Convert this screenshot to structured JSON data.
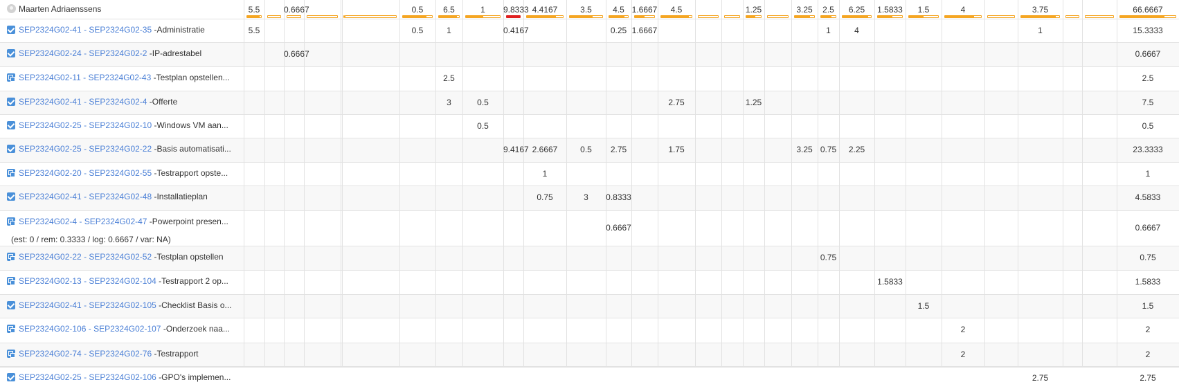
{
  "header": {
    "user_name": "Maarten Adriaenssens",
    "totals": [
      "5.5",
      "",
      "0.6667",
      "",
      "",
      "",
      "0.5",
      "6.5",
      "1",
      "9.8333",
      "4.4167",
      "3.5",
      "4.5",
      "1.6667",
      "4.5",
      "",
      "",
      "1.25",
      "",
      "3.25",
      "2.5",
      "6.25",
      "1.5833",
      "1.5",
      "4",
      "",
      "3.75",
      "",
      "",
      "66.6667"
    ],
    "bar_fill": [
      0.9,
      0,
      0,
      0,
      0,
      0,
      0.8,
      0.9,
      0.5,
      1.0,
      0.8,
      0.7,
      0.8,
      0.5,
      0.9,
      0,
      0,
      0.6,
      0,
      0.8,
      0.7,
      0.9,
      0.6,
      0.5,
      0.8,
      0,
      0.9,
      0,
      0,
      0.8
    ],
    "bar_over": [
      false,
      false,
      false,
      false,
      false,
      false,
      false,
      false,
      false,
      true,
      false,
      false,
      false,
      false,
      false,
      false,
      false,
      false,
      false,
      false,
      false,
      false,
      false,
      false,
      false,
      false,
      false,
      false,
      false,
      false
    ],
    "colors": {
      "accent": "#f5a623",
      "over": "#e02020",
      "link": "#4a7fd6",
      "checkbox": "#4a90d9"
    }
  },
  "rows": [
    {
      "icon": "checkbox-icon",
      "link": "SEP2324G02-41 - SEP2324G02-35",
      "title": " -Administratie",
      "cells": [
        "5.5",
        "",
        "",
        "",
        "",
        "",
        "0.5",
        "1",
        "",
        "0.4167",
        "",
        "",
        "0.25",
        "1.6667",
        "",
        "",
        "",
        "",
        "",
        "",
        "1",
        "4",
        "",
        "",
        "",
        "",
        "1",
        "",
        "",
        "15.3333"
      ]
    },
    {
      "icon": "checkbox-icon",
      "link": "SEP2324G02-24 - SEP2324G02-2",
      "title": " -IP-adrestabel",
      "cells": [
        "",
        "",
        "0.6667",
        "",
        "",
        "",
        "",
        "",
        "",
        "",
        "",
        "",
        "",
        "",
        "",
        "",
        "",
        "",
        "",
        "",
        "",
        "",
        "",
        "",
        "",
        "",
        "",
        "",
        "",
        "0.6667"
      ]
    },
    {
      "icon": "subtask-icon",
      "link": "SEP2324G02-11 - SEP2324G02-43",
      "title": " -Testplan opstellen...",
      "cells": [
        "",
        "",
        "",
        "",
        "",
        "",
        "",
        "2.5",
        "",
        "",
        "",
        "",
        "",
        "",
        "",
        "",
        "",
        "",
        "",
        "",
        "",
        "",
        "",
        "",
        "",
        "",
        "",
        "",
        "",
        "2.5"
      ]
    },
    {
      "icon": "checkbox-icon",
      "link": "SEP2324G02-41 - SEP2324G02-4",
      "title": " -Offerte",
      "cells": [
        "",
        "",
        "",
        "",
        "",
        "",
        "",
        "3",
        "0.5",
        "",
        "",
        "",
        "",
        "",
        "2.75",
        "",
        "",
        "1.25",
        "",
        "",
        "",
        "",
        "",
        "",
        "",
        "",
        "",
        "",
        "",
        "7.5"
      ]
    },
    {
      "icon": "checkbox-icon",
      "link": "SEP2324G02-25 - SEP2324G02-10",
      "title": " -Windows VM aan...",
      "cells": [
        "",
        "",
        "",
        "",
        "",
        "",
        "",
        "",
        "0.5",
        "",
        "",
        "",
        "",
        "",
        "",
        "",
        "",
        "",
        "",
        "",
        "",
        "",
        "",
        "",
        "",
        "",
        "",
        "",
        "",
        "0.5"
      ]
    },
    {
      "icon": "checkbox-icon",
      "link": "SEP2324G02-25 - SEP2324G02-22",
      "title": " -Basis automatisati...",
      "cells": [
        "",
        "",
        "",
        "",
        "",
        "",
        "",
        "",
        "",
        "9.4167",
        "2.6667",
        "0.5",
        "2.75",
        "",
        "1.75",
        "",
        "",
        "",
        "",
        "3.25",
        "0.75",
        "2.25",
        "",
        "",
        "",
        "",
        "",
        "",
        "",
        "23.3333"
      ]
    },
    {
      "icon": "subtask-icon",
      "link": "SEP2324G02-20 - SEP2324G02-55",
      "title": " -Testrapport opste...",
      "cells": [
        "",
        "",
        "",
        "",
        "",
        "",
        "",
        "",
        "",
        "",
        "1",
        "",
        "",
        "",
        "",
        "",
        "",
        "",
        "",
        "",
        "",
        "",
        "",
        "",
        "",
        "",
        "",
        "",
        "",
        "1"
      ]
    },
    {
      "icon": "checkbox-icon",
      "link": "SEP2324G02-41 - SEP2324G02-48",
      "title": " -Installatieplan",
      "cells": [
        "",
        "",
        "",
        "",
        "",
        "",
        "",
        "",
        "",
        "",
        "0.75",
        "3",
        "0.8333",
        "",
        "",
        "",
        "",
        "",
        "",
        "",
        "",
        "",
        "",
        "",
        "",
        "",
        "",
        "",
        "",
        "4.5833"
      ]
    },
    {
      "icon": "subtask-icon",
      "link": "SEP2324G02-4 - SEP2324G02-47",
      "title": " -Powerpoint presen...",
      "meta": "(est: 0 / rem: 0.3333 / log: 0.6667 / var: NA)",
      "cells": [
        "",
        "",
        "",
        "",
        "",
        "",
        "",
        "",
        "",
        "",
        "",
        "",
        "0.6667",
        "",
        "",
        "",
        "",
        "",
        "",
        "",
        "",
        "",
        "",
        "",
        "",
        "",
        "",
        "",
        "",
        "0.6667"
      ]
    },
    {
      "icon": "subtask-icon",
      "link": "SEP2324G02-22 - SEP2324G02-52",
      "title": " -Testplan opstellen",
      "cells": [
        "",
        "",
        "",
        "",
        "",
        "",
        "",
        "",
        "",
        "",
        "",
        "",
        "",
        "",
        "",
        "",
        "",
        "",
        "",
        "",
        "0.75",
        "",
        "",
        "",
        "",
        "",
        "",
        "",
        "",
        "0.75"
      ]
    },
    {
      "icon": "subtask-icon",
      "link": "SEP2324G02-13 - SEP2324G02-104",
      "title": " -Testrapport 2 op...",
      "cells": [
        "",
        "",
        "",
        "",
        "",
        "",
        "",
        "",
        "",
        "",
        "",
        "",
        "",
        "",
        "",
        "",
        "",
        "",
        "",
        "",
        "",
        "",
        "1.5833",
        "",
        "",
        "",
        "",
        "",
        "",
        "1.5833"
      ]
    },
    {
      "icon": "checkbox-icon",
      "link": "SEP2324G02-41 - SEP2324G02-105",
      "title": " -Checklist Basis o...",
      "cells": [
        "",
        "",
        "",
        "",
        "",
        "",
        "",
        "",
        "",
        "",
        "",
        "",
        "",
        "",
        "",
        "",
        "",
        "",
        "",
        "",
        "",
        "",
        "",
        "1.5",
        "",
        "",
        "",
        "",
        "",
        "1.5"
      ]
    },
    {
      "icon": "subtask-icon",
      "link": "SEP2324G02-106 - SEP2324G02-107",
      "title": " -Onderzoek naa...",
      "cells": [
        "",
        "",
        "",
        "",
        "",
        "",
        "",
        "",
        "",
        "",
        "",
        "",
        "",
        "",
        "",
        "",
        "",
        "",
        "",
        "",
        "",
        "",
        "",
        "",
        "2",
        "",
        "",
        "",
        "",
        "2"
      ]
    },
    {
      "icon": "subtask-icon",
      "link": "SEP2324G02-74 - SEP2324G02-76",
      "title": " -Testrapport",
      "cells": [
        "",
        "",
        "",
        "",
        "",
        "",
        "",
        "",
        "",
        "",
        "",
        "",
        "",
        "",
        "",
        "",
        "",
        "",
        "",
        "",
        "",
        "",
        "",
        "",
        "2",
        "",
        "",
        "",
        "",
        "2"
      ]
    },
    {
      "icon": "checkbox-icon",
      "link": "SEP2324G02-25 - SEP2324G02-106",
      "title": " -GPO's implemen...",
      "cells": [
        "",
        "",
        "",
        "",
        "",
        "",
        "",
        "",
        "",
        "",
        "",
        "",
        "",
        "",
        "",
        "",
        "",
        "",
        "",
        "",
        "",
        "",
        "",
        "",
        "",
        "",
        "2.75",
        "",
        "",
        "2.75"
      ]
    }
  ]
}
